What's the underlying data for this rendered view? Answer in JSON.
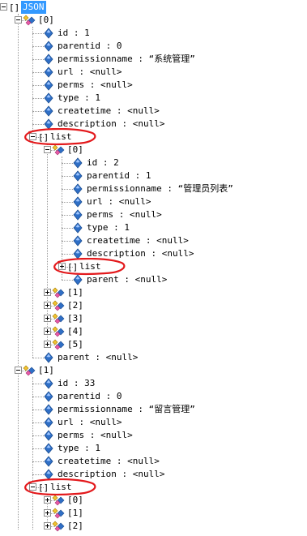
{
  "tree": [
    {
      "depth": 0,
      "kind": "array",
      "label": "JSON",
      "expanded": true,
      "selected": true
    },
    {
      "depth": 1,
      "kind": "object",
      "label": "[0]",
      "expanded": true
    },
    {
      "depth": 2,
      "kind": "prop",
      "label": "id : 1"
    },
    {
      "depth": 2,
      "kind": "prop",
      "label": "parentid : 0"
    },
    {
      "depth": 2,
      "kind": "prop",
      "label": "permissionname : “系统管理”"
    },
    {
      "depth": 2,
      "kind": "prop",
      "label": "url : <null>"
    },
    {
      "depth": 2,
      "kind": "prop",
      "label": "perms : <null>"
    },
    {
      "depth": 2,
      "kind": "prop",
      "label": "type : 1"
    },
    {
      "depth": 2,
      "kind": "prop",
      "label": "createtime : <null>"
    },
    {
      "depth": 2,
      "kind": "prop",
      "label": "description : <null>"
    },
    {
      "depth": 2,
      "kind": "array",
      "label": "list",
      "expanded": true,
      "circled": true
    },
    {
      "depth": 3,
      "kind": "object",
      "label": "[0]",
      "expanded": true
    },
    {
      "depth": 4,
      "kind": "prop",
      "label": "id : 2"
    },
    {
      "depth": 4,
      "kind": "prop",
      "label": "parentid : 1"
    },
    {
      "depth": 4,
      "kind": "prop",
      "label": "permissionname : “管理员列表”"
    },
    {
      "depth": 4,
      "kind": "prop",
      "label": "url : <null>"
    },
    {
      "depth": 4,
      "kind": "prop",
      "label": "perms : <null>"
    },
    {
      "depth": 4,
      "kind": "prop",
      "label": "type : 1"
    },
    {
      "depth": 4,
      "kind": "prop",
      "label": "createtime : <null>"
    },
    {
      "depth": 4,
      "kind": "prop",
      "label": "description : <null>"
    },
    {
      "depth": 4,
      "kind": "array",
      "label": "list",
      "expanded": false,
      "circled": true
    },
    {
      "depth": 4,
      "kind": "prop",
      "label": "parent : <null>"
    },
    {
      "depth": 3,
      "kind": "object",
      "label": "[1]",
      "expanded": false
    },
    {
      "depth": 3,
      "kind": "object",
      "label": "[2]",
      "expanded": false
    },
    {
      "depth": 3,
      "kind": "object",
      "label": "[3]",
      "expanded": false
    },
    {
      "depth": 3,
      "kind": "object",
      "label": "[4]",
      "expanded": false
    },
    {
      "depth": 3,
      "kind": "object",
      "label": "[5]",
      "expanded": false
    },
    {
      "depth": 2,
      "kind": "prop",
      "label": "parent : <null>"
    },
    {
      "depth": 1,
      "kind": "object",
      "label": "[1]",
      "expanded": true
    },
    {
      "depth": 2,
      "kind": "prop",
      "label": "id : 33"
    },
    {
      "depth": 2,
      "kind": "prop",
      "label": "parentid : 0"
    },
    {
      "depth": 2,
      "kind": "prop",
      "label": "permissionname : “留言管理”"
    },
    {
      "depth": 2,
      "kind": "prop",
      "label": "url : <null>"
    },
    {
      "depth": 2,
      "kind": "prop",
      "label": "perms : <null>"
    },
    {
      "depth": 2,
      "kind": "prop",
      "label": "type : 1"
    },
    {
      "depth": 2,
      "kind": "prop",
      "label": "createtime : <null>"
    },
    {
      "depth": 2,
      "kind": "prop",
      "label": "description : <null>"
    },
    {
      "depth": 2,
      "kind": "array",
      "label": "list",
      "expanded": true,
      "circled": true
    },
    {
      "depth": 3,
      "kind": "object",
      "label": "[0]",
      "expanded": false
    },
    {
      "depth": 3,
      "kind": "object",
      "label": "[1]",
      "expanded": false
    },
    {
      "depth": 3,
      "kind": "object",
      "label": "[2]",
      "expanded": false
    }
  ],
  "colors": {
    "selection": "#3399ff",
    "annotation": "#e3191c",
    "prop_icon": "#2f6fc6",
    "tree_line": "#9a9a9a"
  },
  "icons": {
    "prop": "blue-diamond-icon",
    "object": "object-shapes-icon",
    "array": "brackets-icon"
  }
}
